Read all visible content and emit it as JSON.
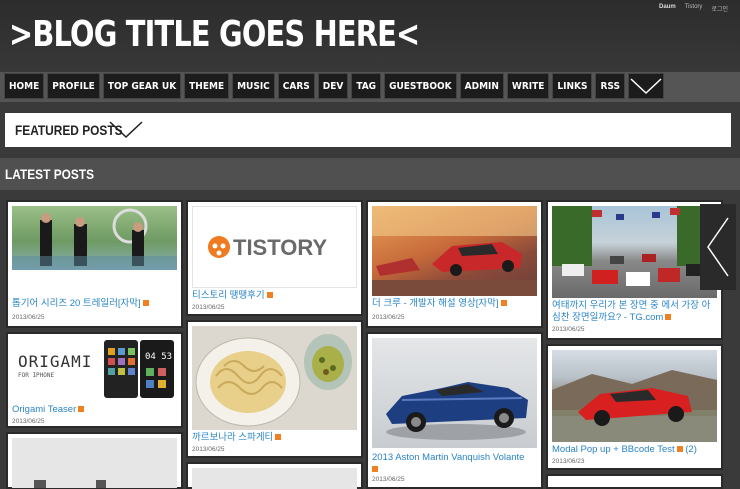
{
  "header": {
    "blog_title": ">BLOG TITLE GOES HERE<",
    "top_links": [
      "Daum",
      "Tistory",
      "로그인"
    ]
  },
  "nav": {
    "items": [
      "HOME",
      "PROFILE",
      "TOP GEAR UK",
      "THEME",
      "MUSIC",
      "CARS",
      "DEV",
      "TAG",
      "GUESTBOOK",
      "ADMIN",
      "WRITE",
      "LINKS",
      "RSS"
    ]
  },
  "featured": {
    "label": "FEATURED POSTS"
  },
  "latest": {
    "label": "LATEST POSTS"
  },
  "posts": [
    {
      "title": "톱기어 시리즈 20 트레일러[자막]",
      "date": "2013/06/25"
    },
    {
      "title": "Origami Teaser",
      "date": "2013/06/25"
    },
    {
      "title": "티스토리 땡땡후기",
      "date": "2013/06/25",
      "logo_text": "TISTORY"
    },
    {
      "title": "까르보나라 스파게티",
      "date": "2013/06/25"
    },
    {
      "title": "더 크루 - 개발자 해설 영상[자막]",
      "date": "2013/06/25"
    },
    {
      "title": "2013 Aston Martin Vanquish Volante",
      "date": "2013/06/25"
    },
    {
      "title": "여태까지 우리가 본 장면 중 에서 가장 아심찬 장면일까요? - TG.com",
      "date": "2013/06/25"
    },
    {
      "title": "Modal Pop up + BBcode Test",
      "date": "2013/06/23",
      "comments": "(2)"
    }
  ],
  "origami": {
    "title": "ORIGAMI",
    "subtitle": "FOR IPHONE",
    "time": "04 53"
  },
  "colors": {
    "link": "#2a84c6",
    "rss": "#f08020",
    "nav_bg": "#1c1c1c"
  }
}
